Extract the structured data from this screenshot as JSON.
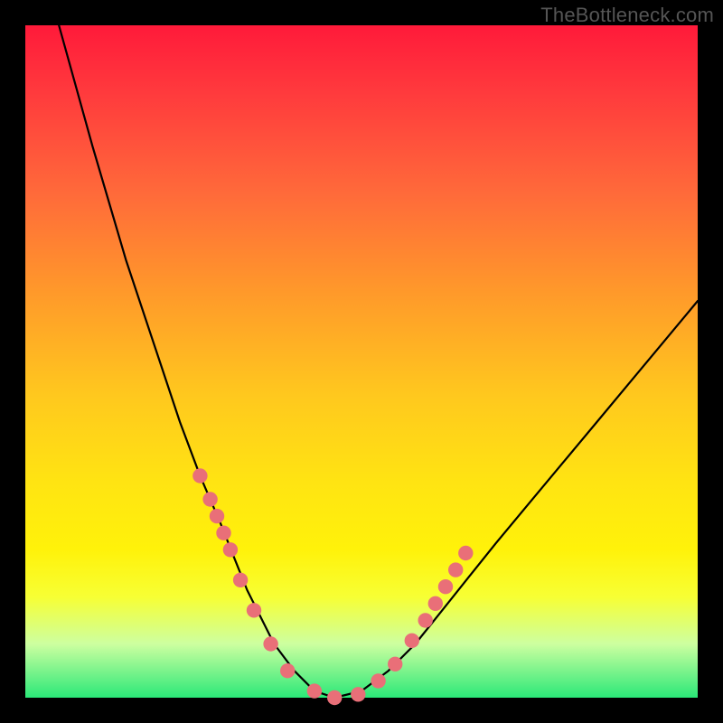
{
  "watermark": "TheBottleneck.com",
  "chart_data": {
    "type": "line",
    "title": "",
    "xlabel": "",
    "ylabel": "",
    "xlim": [
      0,
      100
    ],
    "ylim": [
      0,
      100
    ],
    "series": [
      {
        "name": "curve",
        "x": [
          5,
          10,
          15,
          20,
          23,
          26,
          29,
          31,
          33,
          35,
          37,
          40,
          43,
          46,
          50,
          54,
          58,
          62,
          66,
          70,
          75,
          80,
          85,
          90,
          95,
          100
        ],
        "values": [
          100,
          82,
          65,
          50,
          41,
          33,
          26,
          21,
          16,
          12,
          8,
          4,
          1,
          0,
          1,
          4,
          8,
          13,
          18,
          23,
          29,
          35,
          41,
          47,
          53,
          59
        ]
      }
    ],
    "markers": {
      "name": "dots",
      "color": "#e96f78",
      "radius_pct": 1.1,
      "x": [
        26,
        27.5,
        28.5,
        29.5,
        30.5,
        32,
        34,
        36.5,
        39,
        43,
        46,
        49.5,
        52.5,
        55,
        57.5,
        59.5,
        61,
        62.5,
        64,
        65.5
      ],
      "values": [
        33,
        29.5,
        27,
        24.5,
        22,
        17.5,
        13,
        8,
        4,
        1,
        0,
        0.5,
        2.5,
        5,
        8.5,
        11.5,
        14,
        16.5,
        19,
        21.5
      ]
    },
    "colors": {
      "curve": "#000000",
      "marker": "#e96f78",
      "gradient_top": "#ff1a3a",
      "gradient_bottom": "#2be878"
    }
  }
}
